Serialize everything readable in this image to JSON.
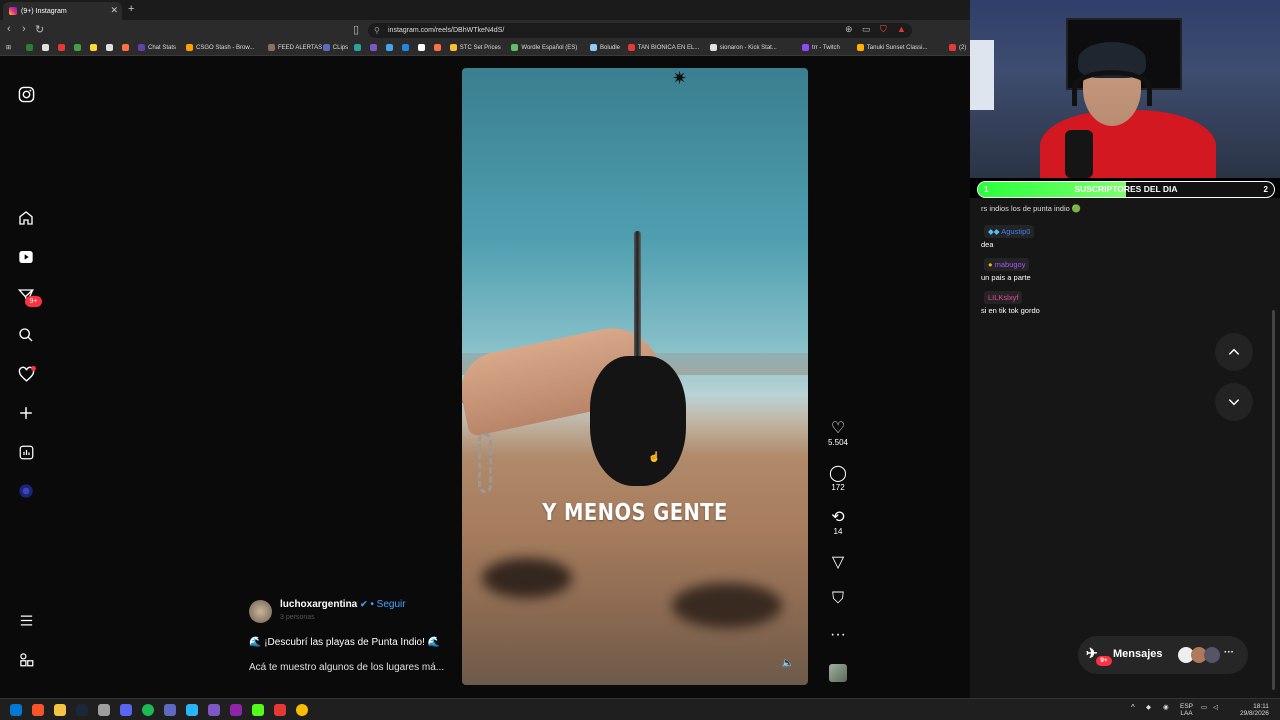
{
  "browser": {
    "tab_title": "(9+) Instagram",
    "url": "instagram.com/reels/DBhWTkeN4dS/",
    "bookmarks": [
      {
        "label": "",
        "color": "#2e7d32"
      },
      {
        "label": "",
        "color": "#e0e0e0"
      },
      {
        "label": "",
        "color": "#e53935"
      },
      {
        "label": "",
        "color": "#43a047"
      },
      {
        "label": "",
        "color": "#fdd835"
      },
      {
        "label": "",
        "color": "#e0e0e0"
      },
      {
        "label": "",
        "color": "#ff7043"
      },
      {
        "label": "Chat Stats",
        "color": "#6441a5"
      },
      {
        "label": "CSGO Stash - Brow...",
        "color": "#ffa000"
      },
      {
        "label": "FEED ALERTAS",
        "color": "#8d6e63"
      },
      {
        "label": "CLips",
        "color": "#5c6bc0"
      },
      {
        "label": "",
        "color": "#26a69a"
      },
      {
        "label": "",
        "color": "#7e57c2"
      },
      {
        "label": "",
        "color": "#42a5f5"
      },
      {
        "label": "",
        "color": "#1e88e5"
      },
      {
        "label": "",
        "color": "#ffffff"
      },
      {
        "label": "",
        "color": "#ff7043"
      },
      {
        "label": "STC Set Prices",
        "color": "#fbc02d"
      },
      {
        "label": "Wordle Español (ES)",
        "color": "#66bb6a"
      },
      {
        "label": "Boludle",
        "color": "#90caf9"
      },
      {
        "label": "TAN BIONICA EN EL...",
        "color": "#e53935"
      },
      {
        "label": "sionaron - Kick Stat...",
        "color": "#e0e0e0"
      },
      {
        "label": "trr - Twitch",
        "color": "#9146ff"
      },
      {
        "label": "Tanuki Sunset Classi...",
        "color": "#ffb300"
      },
      {
        "label": "(2)",
        "color": "#e53935"
      }
    ]
  },
  "sidebar": {
    "logo_icon": "instagram-icon",
    "items": [
      {
        "name": "home",
        "glyph": "⌂"
      },
      {
        "name": "reels",
        "glyph": "▶"
      },
      {
        "name": "direct",
        "glyph": "✈",
        "badge": "9+"
      },
      {
        "name": "search",
        "glyph": "⌕"
      },
      {
        "name": "notifications",
        "glyph": "♡"
      },
      {
        "name": "create",
        "glyph": "+"
      },
      {
        "name": "dashboard",
        "glyph": "▣"
      },
      {
        "name": "profile",
        "glyph": "●"
      }
    ],
    "more_glyph": "≡",
    "meta_glyph": "⊞"
  },
  "reel": {
    "caption_overlay": "Y MENOS GENTE",
    "likes": "5.504",
    "comments": "172",
    "reposts": "14",
    "username": "luchoxargentina",
    "follow_label": "Seguir",
    "audio": "3 personas",
    "description_line1": "🌊 ¡Descubrí las playas de Punta Indio! 🌊",
    "description_line2": "Acá te muestro algunos de los lugares má..."
  },
  "overlay": {
    "sub_bar_label": "SUSCRIPTORES DEL DIA",
    "sub_left": "1",
    "sub_right": "2",
    "sub_progress": 0.5,
    "chat_partial": "rs indios los de punta indio 🟢",
    "chat": [
      {
        "user": "Agustip0",
        "color": "#3b82f6",
        "message": "dea"
      },
      {
        "user": "mabugoy",
        "color": "#a855f7",
        "message": "un pais a parte"
      },
      {
        "user": "LILKslxyf",
        "color": "#ec4899",
        "message": "si en tik tok gordo"
      }
    ],
    "messages_label": "Mensajes",
    "messages_badge": "9+"
  },
  "taskbar": {
    "lang": "ESP",
    "layout": "LAA",
    "time": "18:11",
    "date": "29/8/2026"
  }
}
